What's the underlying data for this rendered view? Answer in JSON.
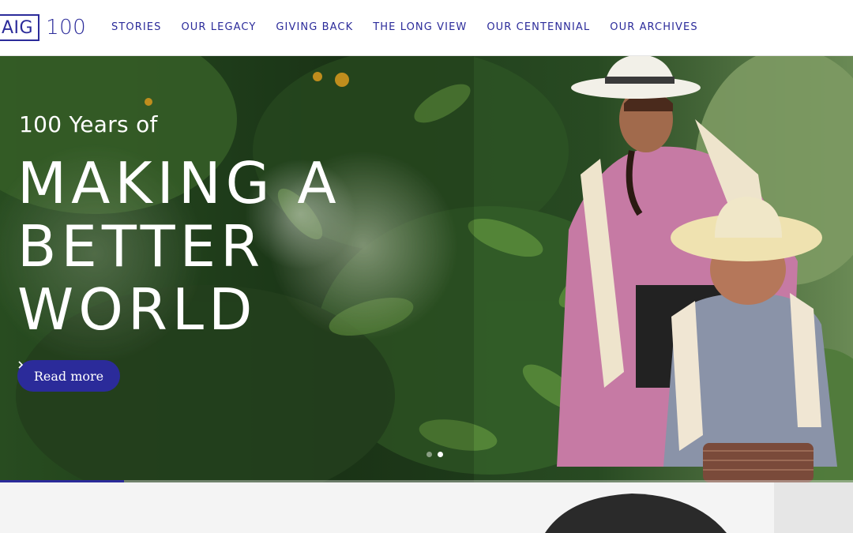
{
  "brand": {
    "logo_left": "AIG",
    "logo_right": "100"
  },
  "nav": {
    "items": [
      "STORIES",
      "OUR LEGACY",
      "GIVING BACK",
      "THE LONG VIEW",
      "OUR CENTENNIAL",
      "OUR ARCHIVES"
    ]
  },
  "hero": {
    "eyebrow": "100 Years of",
    "headline_lines": [
      "MAKING A",
      "BETTER",
      "WORLD"
    ],
    "cta_label": "Read more",
    "cta_icon": "chevron-right-icon",
    "slides_total": 2,
    "active_slide": 2,
    "slide_progress_pct": 14.5
  },
  "colors": {
    "brand": "#2b2b9a",
    "header_bg": "#ffffff"
  }
}
